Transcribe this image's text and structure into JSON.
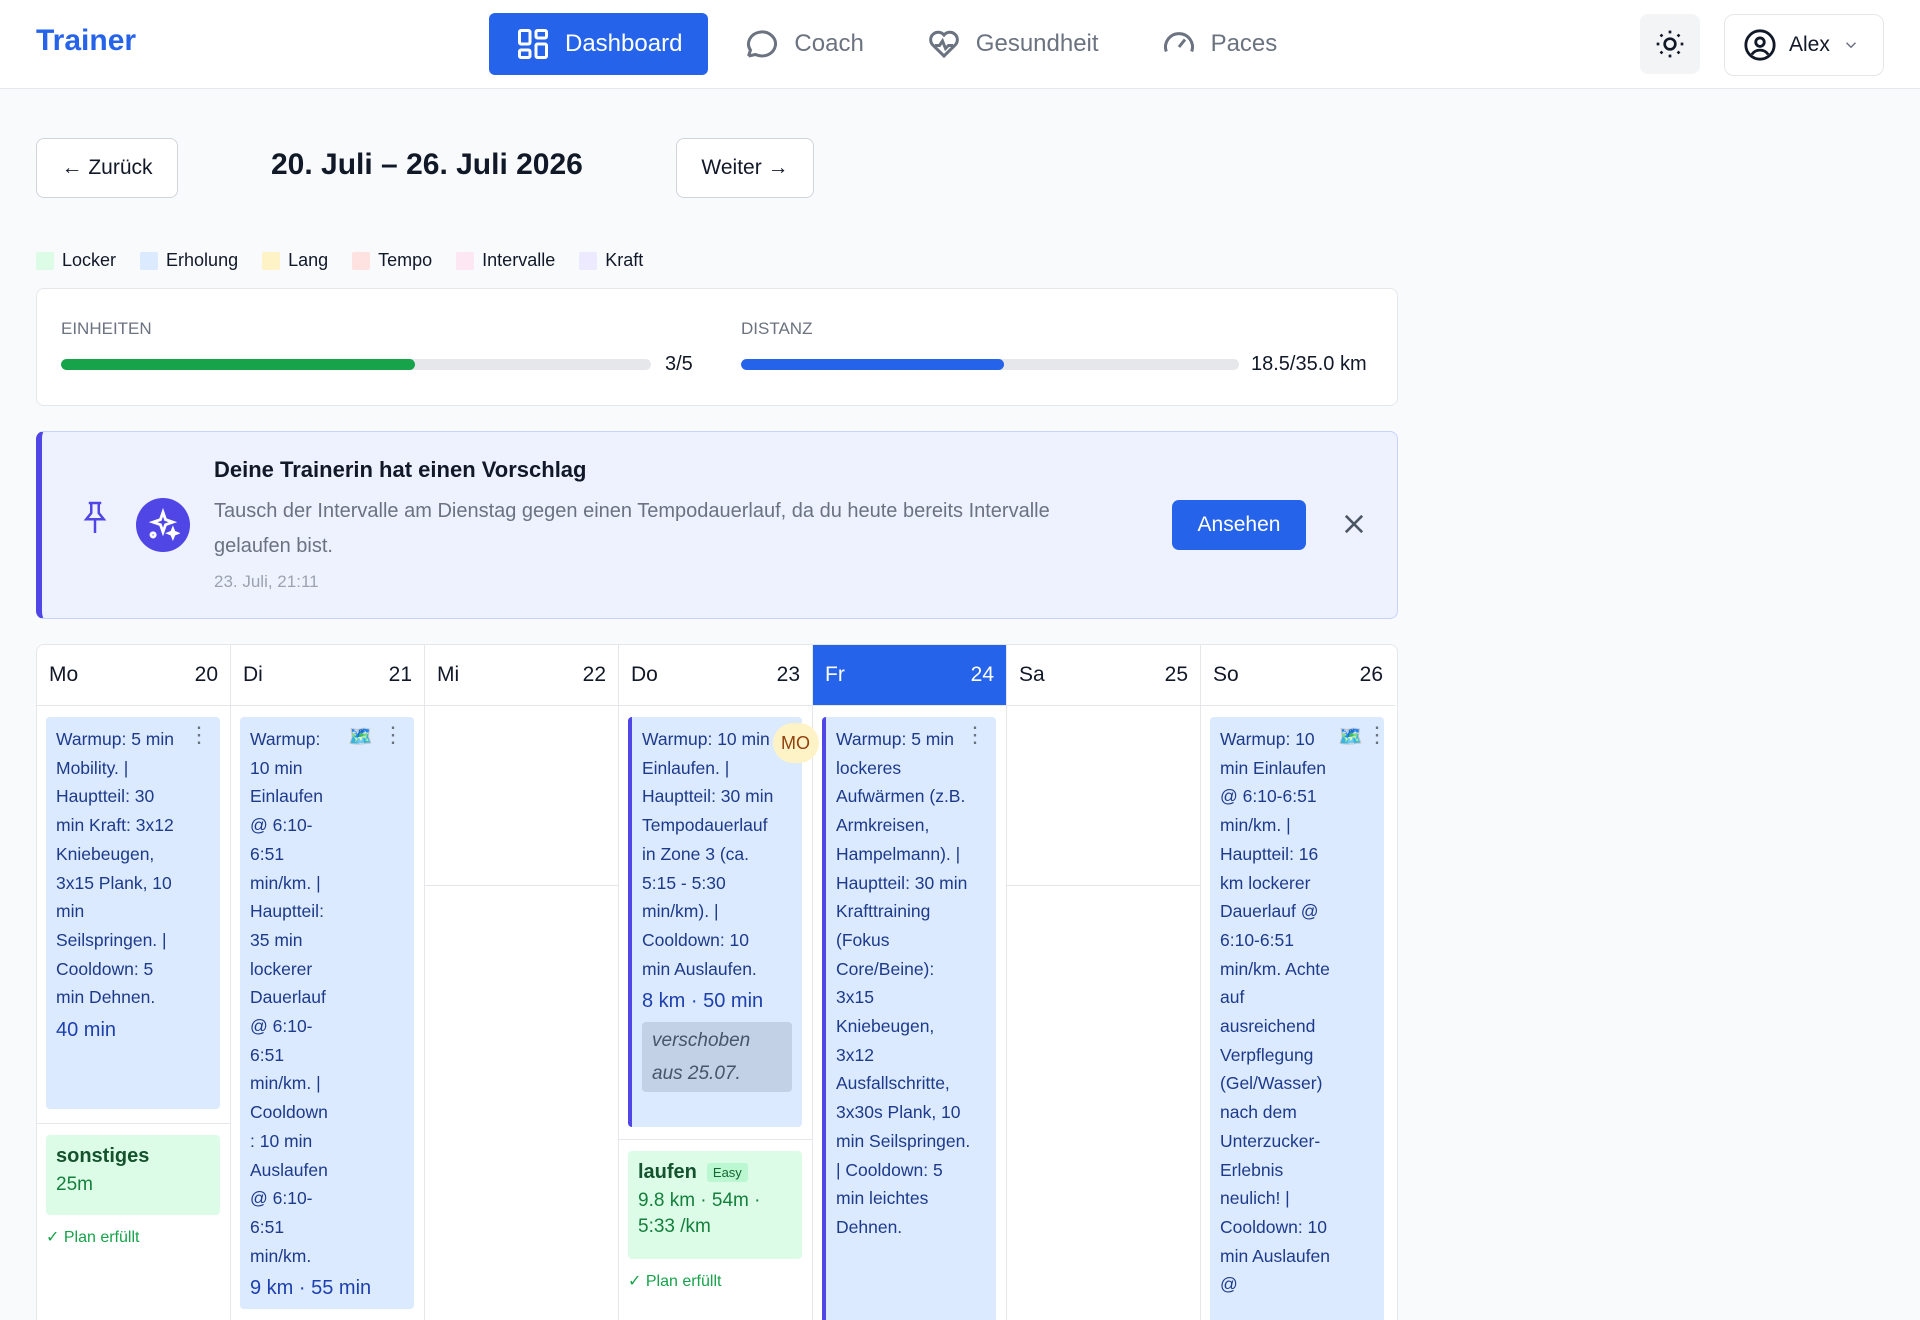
{
  "app": {
    "brand": "Trainer"
  },
  "nav": {
    "items": [
      {
        "label": "Dashboard",
        "icon": "dashboard-grid-icon",
        "active": true
      },
      {
        "label": "Coach",
        "icon": "chat-bubble-icon",
        "active": false
      },
      {
        "label": "Gesundheit",
        "icon": "heart-pulse-icon",
        "active": false
      },
      {
        "label": "Paces",
        "icon": "gauge-icon",
        "active": false
      }
    ]
  },
  "user": {
    "name": "Alex",
    "theme_icon": "sun-icon"
  },
  "week": {
    "prev_label": "← Zurück",
    "title": "20. Juli – 26. Juli 2026",
    "next_label": "Weiter →"
  },
  "legend": [
    {
      "label": "Locker",
      "color": "#dcfce7"
    },
    {
      "label": "Erholung",
      "color": "#dbeafe"
    },
    {
      "label": "Lang",
      "color": "#fef3c7"
    },
    {
      "label": "Tempo",
      "color": "#fee2e2"
    },
    {
      "label": "Intervalle",
      "color": "#fce7f3"
    },
    {
      "label": "Kraft",
      "color": "#ede9fe"
    }
  ],
  "stats": {
    "units_label": "EINHEITEN",
    "units_value": "3/5",
    "units_progress": 0.6,
    "distance_label": "DISTANZ",
    "distance_value": "18.5/35.0 km",
    "distance_progress": 0.529,
    "colors": {
      "units": "#16a34a",
      "distance": "#2563eb"
    }
  },
  "suggestion": {
    "title": "Deine Trainerin hat einen Vorschlag",
    "text": "Tausch der Intervalle am Dienstag gegen einen Tempodauerlauf, da du heute bereits Intervalle gelaufen bist.",
    "timestamp": "23. Juli, 21:11",
    "action_label": "Ansehen"
  },
  "calendar": {
    "days": [
      {
        "name": "Mo",
        "num": "20"
      },
      {
        "name": "Di",
        "num": "21"
      },
      {
        "name": "Mi",
        "num": "22"
      },
      {
        "name": "Do",
        "num": "23"
      },
      {
        "name": "Fr",
        "num": "24",
        "today": true
      },
      {
        "name": "Sa",
        "num": "25"
      },
      {
        "name": "So",
        "num": "26"
      }
    ],
    "workouts": {
      "mo": {
        "text": "Warmup: 5 min Mobility. | Hauptteil: 30 min Kraft: 3x12 Kniebeugen, 3x15 Plank, 10 min Seilspringen. | Cooldown: 5 min Dehnen.",
        "duration": "40 min"
      },
      "di": {
        "text": "Warmup: 10 min Einlaufen @ 6:10-6:51 min/km. | Hauptteil: 35 min lockerer Dauerlauf @ 6:10-6:51 min/km. | Cooldown: 10 min Auslaufen @ 6:10-6:51 min/km.",
        "duration": "9 km · 55 min",
        "map_icon": "map-icon"
      },
      "do": {
        "text": "Warmup: 10 min Einlaufen. | Hauptteil: 30 min Tempodauerlauf in Zone 3 (ca. 5:15 - 5:30 min/km). | Cooldown: 10 min Auslaufen.",
        "duration": "8 km · 50 min",
        "moved_note": "verschoben aus 25.07.",
        "badge": "MO"
      },
      "fr": {
        "text": "Warmup: 5 min lockeres Aufwärmen (z.B. Armkreisen, Hampelmann). | Hauptteil: 30 min Krafttraining (Fokus Core/Beine): 3x15 Kniebeugen, 3x12 Ausfallschritte, 3x30s Plank, 10 min Seilspringen. | Cooldown: 5 min leichtes Dehnen."
      },
      "so": {
        "text": "Warmup: 10 min Einlaufen @ 6:10-6:51 min/km. | Hauptteil: 16 km lockerer Dauerlauf @ 6:10-6:51 min/km. Achte auf ausreichend Verpflegung (Gel/Wasser) nach dem Unterzucker-Erlebnis neulich! | Cooldown: 10 min Auslaufen @",
        "map_icon": "map-icon"
      }
    },
    "activities": {
      "mo": {
        "title": "sonstiges",
        "meta": "25m",
        "status": "✓ Plan erfüllt"
      },
      "do": {
        "title": "laufen",
        "tag": "Easy",
        "meta": "9.8 km · 54m · 5:33 /km",
        "status": "✓ Plan erfüllt"
      }
    }
  }
}
